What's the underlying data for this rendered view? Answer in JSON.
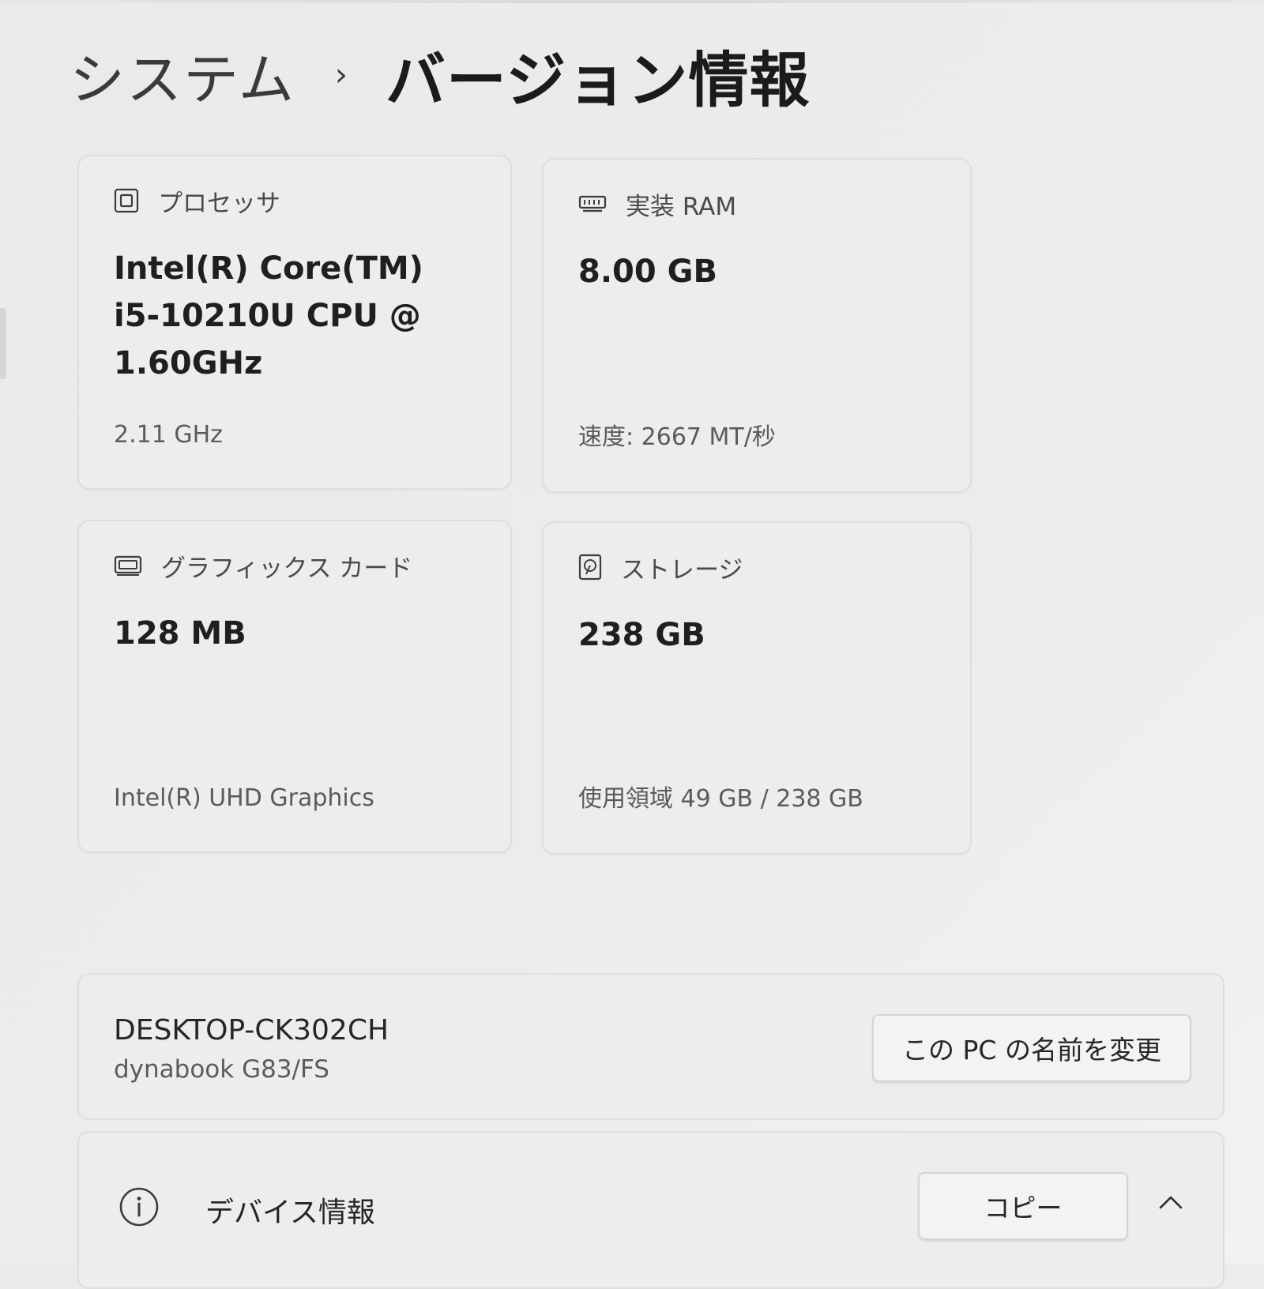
{
  "breadcrumb": {
    "parent": "システム",
    "separator": "›",
    "current": "バージョン情報"
  },
  "specs": {
    "processor": {
      "icon": "processor-icon",
      "title": "プロセッサ",
      "value_lines": [
        "Intel(R) Core(TM)",
        "i5-10210U CPU @",
        "1.60GHz"
      ],
      "sub": "2.11 GHz"
    },
    "ram": {
      "icon": "ram-icon",
      "title": "実装 RAM",
      "value": "8.00 GB",
      "sub": "速度: 2667 MT/秒"
    },
    "graphics": {
      "icon": "graphics-card-icon",
      "title": "グラフィックス カード",
      "value": "128 MB",
      "sub": "Intel(R) UHD Graphics"
    },
    "storage": {
      "icon": "storage-icon",
      "title": "ストレージ",
      "value": "238 GB",
      "sub": "使用領域 49 GB / 238 GB"
    }
  },
  "pc": {
    "name": "DESKTOP-CK302CH",
    "model": "dynabook G83/FS",
    "rename_label": "この PC の名前を変更"
  },
  "device_info": {
    "icon": "info-icon",
    "title": "デバイス情報",
    "copy_label": "コピー",
    "chevron": "chevron-up-icon"
  },
  "colors": {
    "background": "#ececed",
    "card": "#ededee",
    "text_primary": "#1f1f1f",
    "text_secondary": "#5b5b5b"
  }
}
